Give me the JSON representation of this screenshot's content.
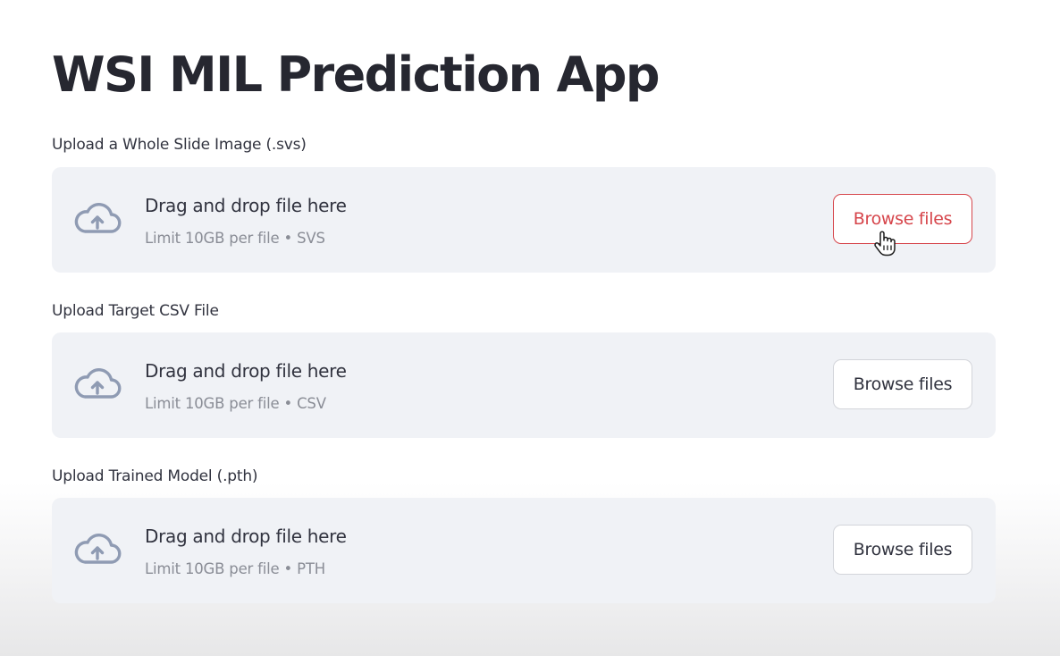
{
  "app": {
    "title": "WSI MIL Prediction App"
  },
  "uploaders": [
    {
      "label": "Upload a Whole Slide Image (.svs)",
      "drag_text": "Drag and drop file here",
      "limit_text": "Limit 10GB per file • SVS",
      "button_label": "Browse files",
      "button_state": "hover",
      "icon": "upload-cloud-icon"
    },
    {
      "label": "Upload Target CSV File",
      "drag_text": "Drag and drop file here",
      "limit_text": "Limit 10GB per file • CSV",
      "button_label": "Browse files",
      "button_state": "default",
      "icon": "upload-cloud-icon"
    },
    {
      "label": "Upload Trained Model (.pth)",
      "drag_text": "Drag and drop file here",
      "limit_text": "Limit 10GB per file • PTH",
      "button_label": "Browse files",
      "button_state": "default",
      "icon": "upload-cloud-icon"
    }
  ],
  "cursor": {
    "icon": "hand-pointer-cursor-icon"
  },
  "colors": {
    "accent": "#d6454b",
    "dropzone_bg": "#f0f2f6",
    "icon": "#8f9bb3",
    "text": "#31333f",
    "muted_text": "#8a8d96"
  }
}
